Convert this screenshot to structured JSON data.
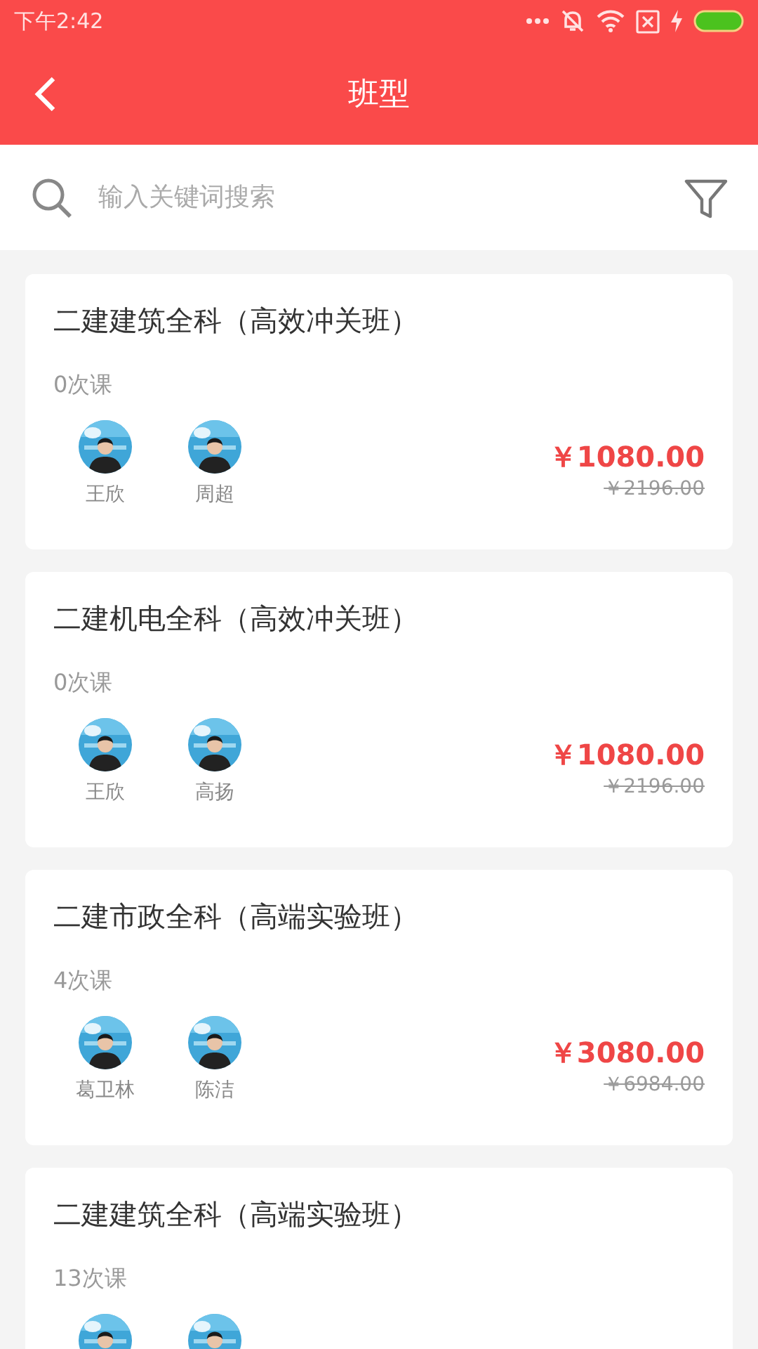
{
  "status_bar": {
    "time": "下午2:42"
  },
  "header": {
    "title": "班型"
  },
  "search": {
    "placeholder": "输入关键词搜索"
  },
  "courses": [
    {
      "title": "二建建筑全科（高效冲关班）",
      "lessons": "0次课",
      "teachers": [
        {
          "name": "王欣"
        },
        {
          "name": "周超"
        }
      ],
      "price": "￥1080.00",
      "original_price": "￥2196.00"
    },
    {
      "title": "二建机电全科（高效冲关班）",
      "lessons": "0次课",
      "teachers": [
        {
          "name": "王欣"
        },
        {
          "name": "高扬"
        }
      ],
      "price": "￥1080.00",
      "original_price": "￥2196.00"
    },
    {
      "title": "二建市政全科（高端实验班）",
      "lessons": "4次课",
      "teachers": [
        {
          "name": "葛卫林"
        },
        {
          "name": "陈洁"
        }
      ],
      "price": "￥3080.00",
      "original_price": "￥6984.00"
    },
    {
      "title": "二建建筑全科（高端实验班）",
      "lessons": "13次课"
    }
  ]
}
